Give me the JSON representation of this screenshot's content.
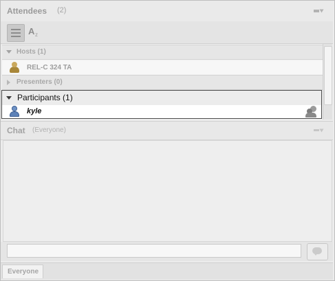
{
  "attendees": {
    "title": "Attendees",
    "count": "(2)",
    "sections": {
      "hosts": {
        "label": "Hosts (1)",
        "members": [
          {
            "name": "REL-C 324 TA"
          }
        ]
      },
      "presenters": {
        "label": "Presenters (0)"
      },
      "participants": {
        "label": "Participants (1)",
        "members": [
          {
            "name": "kyle"
          }
        ]
      }
    }
  },
  "chat": {
    "title": "Chat",
    "scope": "(Everyone)",
    "input_value": "",
    "tabs": [
      {
        "label": "Everyone"
      }
    ]
  },
  "icons": {
    "pod_menu": "pod-options-menu-icon",
    "list_view": "list-view-icon",
    "sort": "sort-alpha-icon",
    "host": "host-user-icon",
    "participant": "participant-user-icon",
    "role": "change-role-icon",
    "send": "send-message-icon"
  }
}
